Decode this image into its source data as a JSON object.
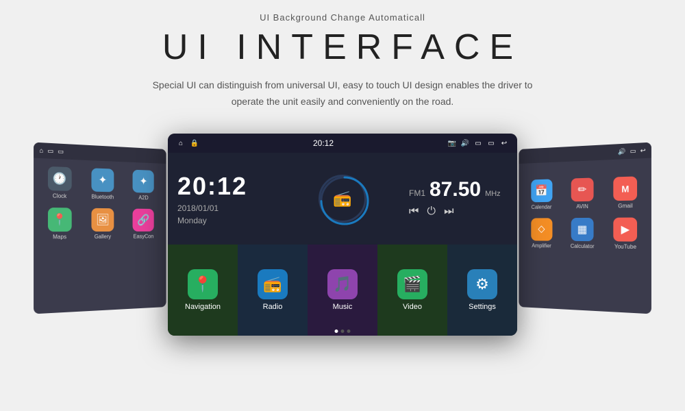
{
  "page": {
    "top_label": "UI Background Change Automaticall",
    "main_title": "UI INTERFACE",
    "description_line1": "Special UI can distinguish from universal UI, easy to touch UI design enables the driver to",
    "description_line2": "operate the unit easily and conveniently on the road."
  },
  "center_screen": {
    "status_bar": {
      "time": "20:12",
      "home_icon": "⌂",
      "lock_icon": "🔒"
    },
    "clock": {
      "time": "20:12",
      "date": "2018/01/01",
      "day": "Monday"
    },
    "radio": {
      "fm_label": "FM1",
      "frequency": "87.50",
      "unit": "MHz"
    },
    "apps": [
      {
        "name": "Navigation",
        "icon": "📍",
        "bg": "#27ae60"
      },
      {
        "name": "Radio",
        "icon": "📻",
        "bg": "#1a7abf"
      },
      {
        "name": "Music",
        "icon": "🎵",
        "bg": "#8e44ad"
      },
      {
        "name": "Video",
        "icon": "🎬",
        "bg": "#27ae60"
      },
      {
        "name": "Settings",
        "icon": "⚙",
        "bg": "#2980b9"
      }
    ]
  },
  "left_screen": {
    "apps": [
      {
        "name": "Clock",
        "icon": "🕐",
        "bg": "#2c3e50"
      },
      {
        "name": "Bluetooth",
        "icon": "✦",
        "bg": "#2980b9"
      },
      {
        "name": "A2D",
        "icon": "✦",
        "bg": "#2980b9"
      },
      {
        "name": "Maps",
        "icon": "📍",
        "bg": "#27ae60"
      },
      {
        "name": "Gallery",
        "icon": "🖼",
        "bg": "#e67e22"
      },
      {
        "name": "EasyCon",
        "icon": "🔗",
        "bg": "#e91e8c"
      }
    ]
  },
  "right_screen": {
    "apps": [
      {
        "name": "Calendar",
        "icon": "📅",
        "bg": "#2196f3"
      },
      {
        "name": "AVIN",
        "icon": "✏",
        "bg": "#e53935"
      },
      {
        "name": "Gmail",
        "icon": "M",
        "bg": "#f44336"
      },
      {
        "name": "Amplifier",
        "icon": "⬦",
        "bg": "#f57c00"
      },
      {
        "name": "Calculator",
        "icon": "▦",
        "bg": "#1565c0"
      },
      {
        "name": "YouTube",
        "icon": "▶",
        "bg": "#f44336"
      }
    ]
  }
}
